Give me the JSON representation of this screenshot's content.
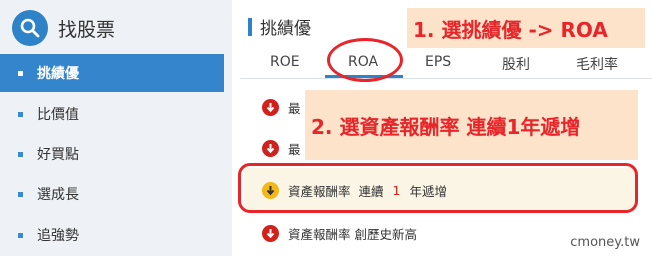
{
  "sidebar": {
    "title": "找股票",
    "items": [
      {
        "label": "挑績優",
        "active": true
      },
      {
        "label": "比價值",
        "active": false
      },
      {
        "label": "好買點",
        "active": false
      },
      {
        "label": "選成長",
        "active": false
      },
      {
        "label": "追強勢",
        "active": false
      }
    ]
  },
  "main": {
    "title": "挑績優",
    "tabs": [
      "ROE",
      "ROA",
      "EPS",
      "股利",
      "毛利率"
    ],
    "selected_tab": "ROA",
    "rows": [
      {
        "prefix": "最"
      },
      {
        "prefix": "最"
      },
      {
        "label_a": "資產報酬率",
        "label_b": "連續",
        "number": "1",
        "label_c": "年遞增"
      },
      {
        "label": "資產報酬率 創歷史新高"
      }
    ]
  },
  "annotations": {
    "step1": "1. 選挑績優 -> ROA",
    "step2": "2. 選資產報酬率 連續1年遞增"
  },
  "watermark": "cmoney.tw",
  "colors": {
    "accent": "#2e82c8",
    "sidebar_active": "#3585cd",
    "annotation_red": "#e8252a",
    "annotation_bg": "#fde3c9"
  }
}
